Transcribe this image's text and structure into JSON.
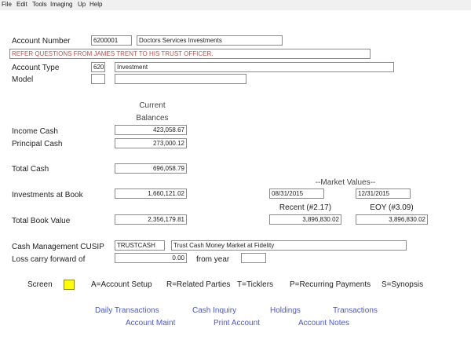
{
  "menu": [
    "File",
    "Edit",
    "Tools",
    "Imaging",
    "Up",
    "Help"
  ],
  "account": {
    "number_label": "Account Number",
    "number": "6200001",
    "name": "Doctors Services Investments",
    "note": "REFER QUESTIONS FROM JAMES TRENT TO HIS TRUST OFFICER.",
    "type_label": "Account Type",
    "type_code": "620",
    "type_name": "Investment",
    "model_label": "Model",
    "model_code": "",
    "model_name": ""
  },
  "balances": {
    "header_line1": "Current",
    "header_line2": "Balances",
    "income_cash_label": "Income Cash",
    "income_cash": "423,058.67",
    "principal_cash_label": "Principal Cash",
    "principal_cash": "273,000.12",
    "total_cash_label": "Total Cash",
    "total_cash": "696,058.79",
    "investments_label": "Investments at Book",
    "investments": "1,660,121.02",
    "total_book_label": "Total Book Value",
    "total_book": "2,356,179.81"
  },
  "market": {
    "header": "--Market Values--",
    "date_recent": "08/31/2015",
    "date_eoy": "12/31/2015",
    "recent_label": "Recent (#2.17)",
    "eoy_label": "EOY (#3.09)",
    "recent_value": "3,896,830.02",
    "eoy_value": "3,896,830.02"
  },
  "cash_mgmt": {
    "label": "Cash Management CUSIP",
    "cusip": "TRUSTCASH",
    "description": "Trust Cash Money Market at Fidelity"
  },
  "loss": {
    "label": "Loss carry forward of",
    "value": "0.00",
    "year_label": "from year",
    "year": ""
  },
  "screen": {
    "label": "Screen",
    "options": [
      "A=Account Setup",
      "R=Related Parties",
      "T=Ticklers",
      "P=Recurring Payments",
      "S=Synopsis"
    ]
  },
  "links_row1": [
    "Daily Transactions",
    "Cash Inquiry",
    "Holdings",
    "Transactions"
  ],
  "links_row2": [
    "Account Maint",
    "Print Account",
    "Account Notes"
  ],
  "colors": {
    "note": "#c0504d",
    "link": "#4a56d8",
    "screen_box": "#ffff00"
  }
}
